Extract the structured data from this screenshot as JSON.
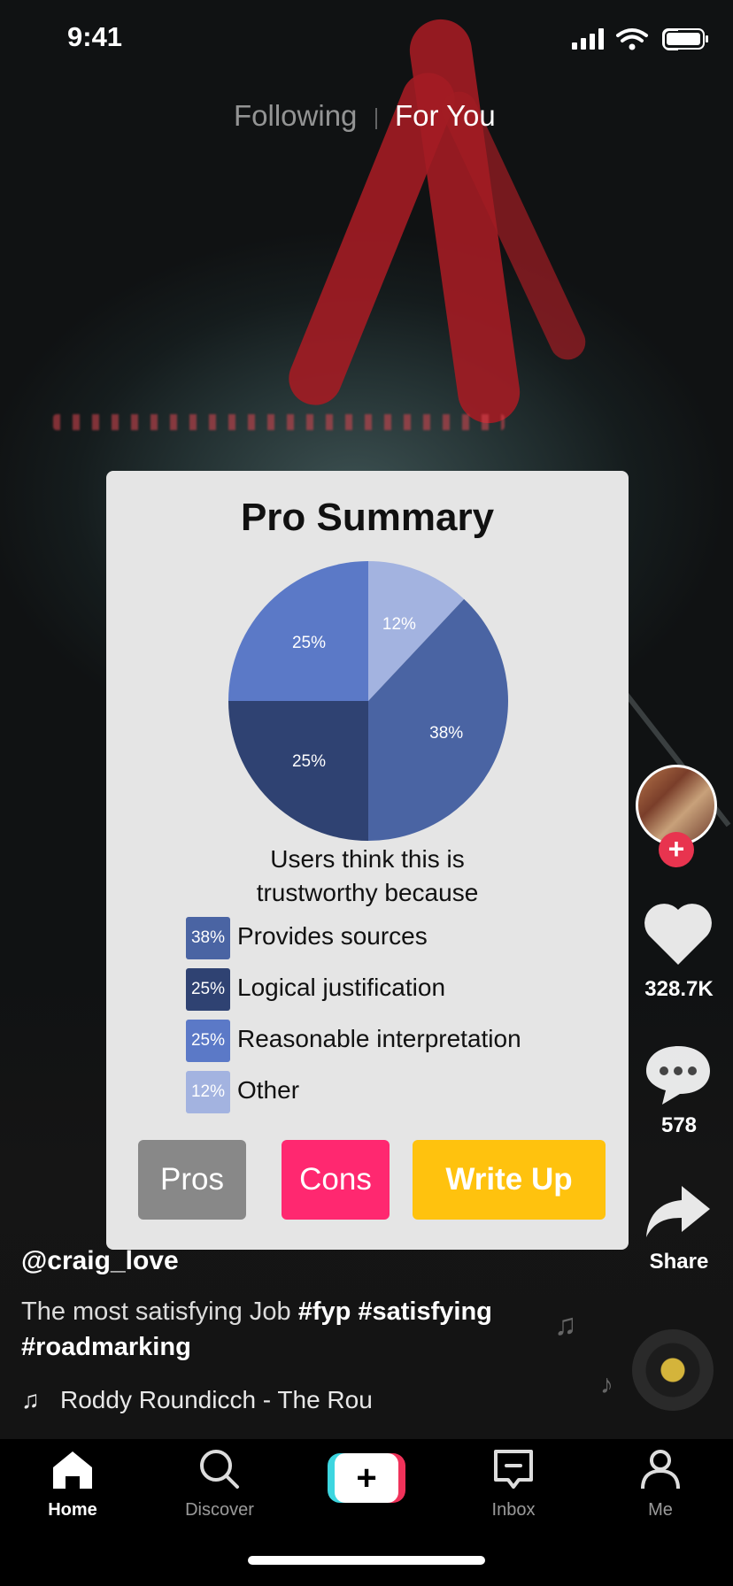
{
  "status_bar": {
    "time": "9:41"
  },
  "top_tabs": {
    "following": "Following",
    "for_you": "For You"
  },
  "right_rail": {
    "likes": "328.7K",
    "comments": "578",
    "share": "Share"
  },
  "video": {
    "handle": "@craig_love",
    "caption_text": "The most satisfying Job ",
    "hashtags": [
      "#fyp",
      "#satisfying",
      "#roadmarking"
    ],
    "music": "Roddy Roundicch - The Rou"
  },
  "card": {
    "title": "Pro Summary",
    "subtitle_line1": "Users think this is",
    "subtitle_line2": "trustworthy because",
    "buttons": {
      "pros": "Pros",
      "cons": "Cons",
      "write_up": "Write Up"
    },
    "colors": {
      "pros": "#888888",
      "cons": "#ff2870",
      "write_up": "#ffc20e"
    }
  },
  "chart_data": {
    "type": "pie",
    "title": "Pro Summary",
    "slices": [
      {
        "label": "Provides sources",
        "value": 38,
        "display": "38%",
        "color": "#4a64a3"
      },
      {
        "label": "Logical justification",
        "value": 25,
        "display": "25%",
        "color": "#2f4272"
      },
      {
        "label": "Reasonable interpretation",
        "value": 25,
        "display": "25%",
        "color": "#5b79c7"
      },
      {
        "label": "Other",
        "value": 12,
        "display": "12%",
        "color": "#a3b3e0"
      }
    ],
    "legend_placement": "bottom"
  },
  "nav": {
    "home": "Home",
    "discover": "Discover",
    "inbox": "Inbox",
    "me": "Me"
  }
}
